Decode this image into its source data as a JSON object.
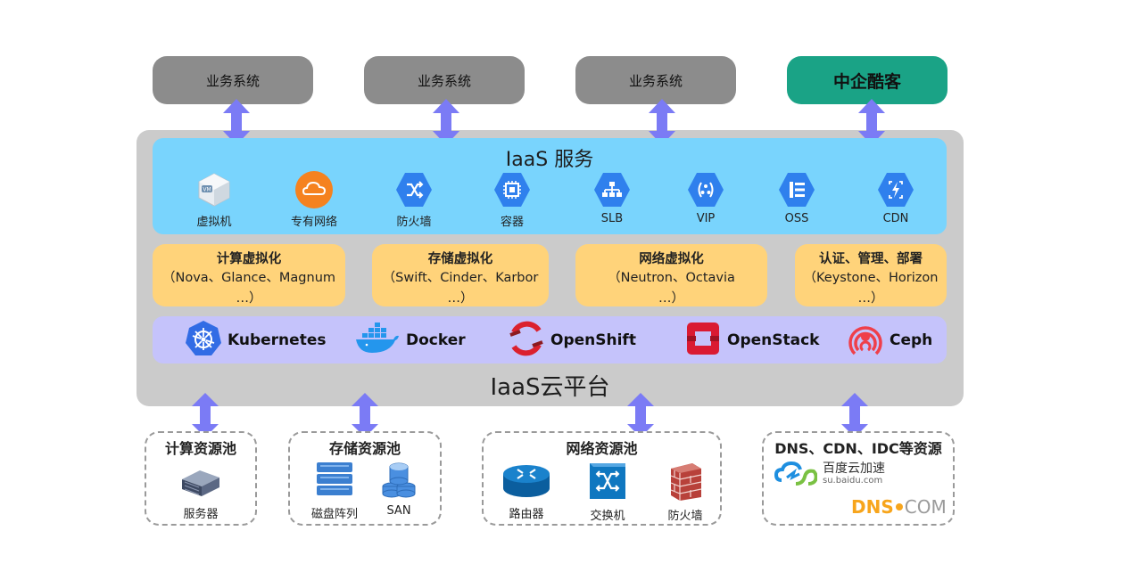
{
  "business": {
    "box1": "业务系统",
    "box2": "业务系统",
    "box3": "业务系统",
    "box4": "中企酷客"
  },
  "iaas_service": {
    "title": "IaaS 服务",
    "items": [
      {
        "label": "虚拟机",
        "icon": "vm-icon"
      },
      {
        "label": "专有网络",
        "icon": "cloud-icon"
      },
      {
        "label": "防火墙",
        "icon": "shuffle-icon"
      },
      {
        "label": "容器",
        "icon": "chip-icon"
      },
      {
        "label": "SLB",
        "icon": "tree-icon"
      },
      {
        "label": "VIP",
        "icon": "vip-icon"
      },
      {
        "label": "OSS",
        "icon": "list-icon"
      },
      {
        "label": "CDN",
        "icon": "cdn-icon"
      }
    ]
  },
  "virtualization": [
    {
      "title": "计算虚拟化",
      "line1": "（Nova、Glance、Magnum",
      "line2": "…）"
    },
    {
      "title": "存储虚拟化",
      "line1": "（Swift、Cinder、Karbor",
      "line2": "…）"
    },
    {
      "title": "网络虚拟化",
      "line1": "（Neutron、Octavia",
      "line2": "…）"
    },
    {
      "title": "认证、管理、部署",
      "line1": "（Keystone、Horizon",
      "line2": "…）"
    }
  ],
  "tech": {
    "kubernetes": "Kubernetes",
    "docker": "Docker",
    "openshift": "OpenShift",
    "openstack": "OpenStack",
    "ceph": "Ceph"
  },
  "platform_title": "IaaS云平台",
  "pools": {
    "compute": {
      "title": "计算资源池",
      "server": "服务器"
    },
    "storage": {
      "title": "存储资源池",
      "array": "磁盘阵列",
      "san": "SAN"
    },
    "network": {
      "title": "网络资源池",
      "router": "路由器",
      "switch": "交换机",
      "firewall": "防火墙"
    },
    "external": {
      "title": "DNS、CDN、IDC等资源",
      "baidu_name": "百度云加速",
      "baidu_url": "su.baidu.com",
      "dns_left": "DNS",
      "dns_right": "COM"
    }
  },
  "colors": {
    "arrow": "#7b7bf5",
    "business_box": "#8c8c8c",
    "accent": "#1aa386",
    "iaas_bg": "#79d4fd",
    "hex_icon": "#2f80ed",
    "virt_bg": "#ffd37a",
    "tech_bg": "#c5c3fb",
    "platform_bg": "#cbcbcb"
  }
}
